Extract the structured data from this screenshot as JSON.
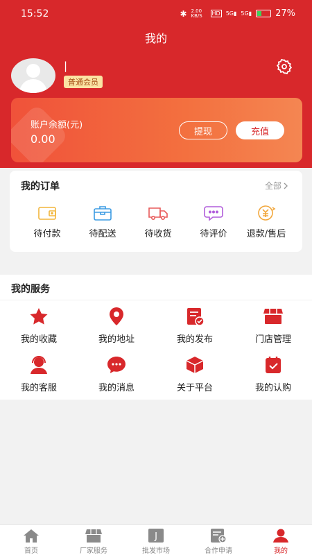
{
  "status_bar": {
    "time": "15:52",
    "network": "2.00 KB/S",
    "hd": "HD",
    "signal_1": "5G",
    "signal_2": "5G",
    "battery": "27%"
  },
  "page_title": "我的",
  "user": {
    "name": "|",
    "badge": "普通会员"
  },
  "balance": {
    "label": "账户余额(元)",
    "value": "0.00",
    "withdraw_label": "提现",
    "recharge_label": "充值"
  },
  "orders": {
    "title": "我的订单",
    "all_label": "全部",
    "items": [
      {
        "label": "待付款",
        "icon": "wallet-icon"
      },
      {
        "label": "待配送",
        "icon": "package-icon"
      },
      {
        "label": "待收货",
        "icon": "truck-icon"
      },
      {
        "label": "待评价",
        "icon": "comment-icon"
      },
      {
        "label": "退款/售后",
        "icon": "refund-icon"
      }
    ]
  },
  "services": {
    "title": "我的服务",
    "items": [
      {
        "label": "我的收藏",
        "icon": "star-icon"
      },
      {
        "label": "我的地址",
        "icon": "location-icon"
      },
      {
        "label": "我的发布",
        "icon": "publish-icon"
      },
      {
        "label": "门店管理",
        "icon": "store-icon"
      },
      {
        "label": "我的客服",
        "icon": "customer-service-icon"
      },
      {
        "label": "我的消息",
        "icon": "message-icon"
      },
      {
        "label": "关于平台",
        "icon": "box-icon"
      },
      {
        "label": "我的认购",
        "icon": "subscribe-icon"
      }
    ]
  },
  "tabbar": {
    "items": [
      {
        "label": "首页",
        "icon": "home-icon",
        "active": false
      },
      {
        "label": "厂家服务",
        "icon": "factory-icon",
        "active": false
      },
      {
        "label": "批发市场",
        "icon": "market-icon",
        "active": false
      },
      {
        "label": "合作申请",
        "icon": "apply-icon",
        "active": false
      },
      {
        "label": "我的",
        "icon": "profile-icon",
        "active": true
      }
    ],
    "market_glyph": "J"
  },
  "colors": {
    "brand": "#d8282b",
    "card_gradient_start": "#f0523a",
    "badge_bg": "#fbe3a4",
    "background": "#f2f2f2"
  }
}
